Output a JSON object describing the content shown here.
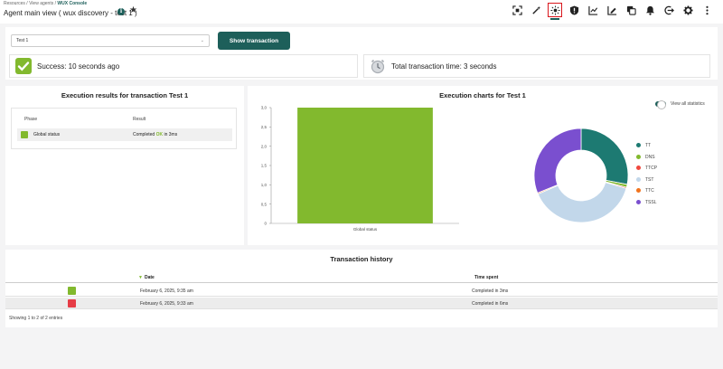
{
  "breadcrumb": {
    "part1": "Resources",
    "part2": "View agents",
    "current": "WUX Console",
    "sep": " / "
  },
  "page_title": "Agent main view ( wux discovery - test 1 )",
  "toolbar_icons": [
    "scan-icon",
    "wand-icon",
    "sun-icon",
    "shield-icon",
    "chart-icon",
    "edit-chart-icon",
    "copy-icon",
    "bell-icon",
    "logout-icon",
    "gear-icon",
    "more-icon"
  ],
  "filter": {
    "selected": "Test 1",
    "button_label": "Show transaction"
  },
  "stats": {
    "success": "Success: 10 seconds ago",
    "total_time": "Total transaction time: 3 seconds"
  },
  "exec_results": {
    "title": "Execution results for transaction Test 1",
    "col_phase": "Phase",
    "col_result": "Result",
    "rows": [
      {
        "phase": "Global status",
        "result_prefix": "Completed",
        "result_ok": "OK",
        "result_suffix": "in 3ms"
      }
    ]
  },
  "charts_title": "Execution charts for Test 1",
  "toggle_label": "View all statistics",
  "chart_data": [
    {
      "type": "bar",
      "categories": [
        "Global status"
      ],
      "values": [
        3.0
      ],
      "ylim": [
        0,
        3
      ],
      "yticks": [
        "0",
        "0,5",
        "1,0",
        "1,5",
        "2,0",
        "2,5",
        "3,0"
      ],
      "color": "#82b92e"
    },
    {
      "type": "pie",
      "labels": [
        "TT",
        "DNS",
        "TTCP",
        "TST",
        "TTC",
        "TSSL"
      ],
      "colors": [
        "#1d7a72",
        "#82b92e",
        "#f0483e",
        "#c2d7ea",
        "#f1731d",
        "#7a4fcf"
      ],
      "values": [
        28,
        1,
        0.4,
        39,
        0.4,
        31
      ]
    }
  ],
  "history": {
    "title": "Transaction history",
    "col_date": "Date",
    "col_time": "Time spent",
    "rows": [
      {
        "status_color": "#82b92e",
        "date": "February 6, 2025, 9:35 am",
        "time": "Completed in 3ms"
      },
      {
        "status_color": "#e63c46",
        "date": "February 6, 2025, 9:33 am",
        "time": "Completed in 6ms"
      }
    ],
    "footer": "Showing 1 to 2 of 2 entries"
  },
  "colors": {
    "accent": "#1d5f5a",
    "success": "#82b92e",
    "error": "#e63c46",
    "highlight": "#d9161c"
  }
}
